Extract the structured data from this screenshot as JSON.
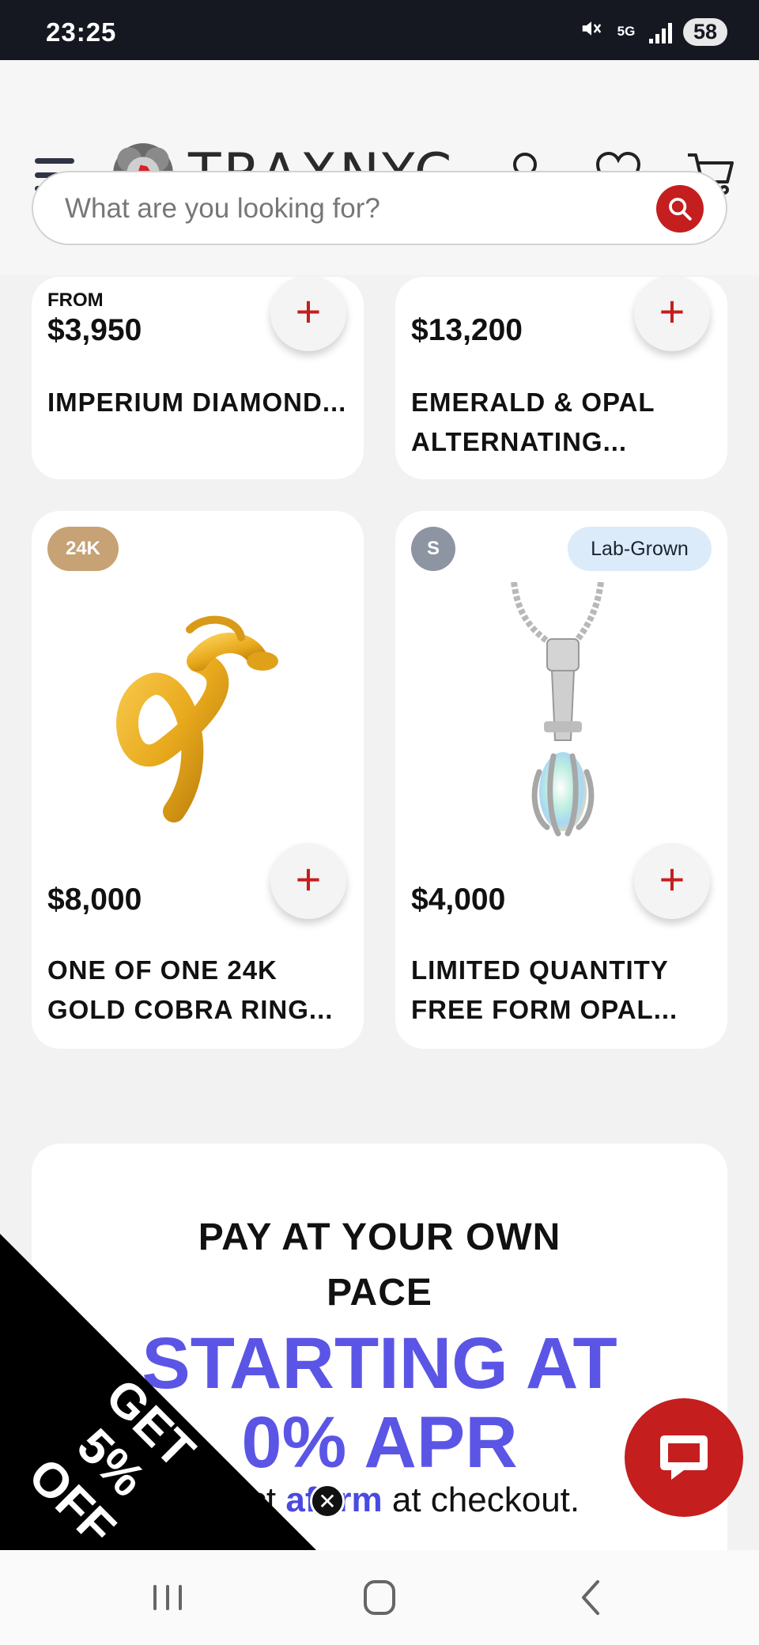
{
  "status_bar": {
    "time": "23:25",
    "network": "5G",
    "battery": "58",
    "icons": [
      "mute-icon",
      "5g-icon",
      "signal-icon",
      "battery-icon"
    ]
  },
  "header": {
    "brand": "TRAXNYC",
    "icons": [
      "menu-icon",
      "logo-icon",
      "account-icon",
      "wishlist-icon",
      "cart-icon"
    ]
  },
  "search": {
    "placeholder": "What are you looking for?",
    "icon": "search-icon"
  },
  "products_top": [
    {
      "from_label": "FROM",
      "price": "$3,950",
      "title": "IMPERIUM DIAMOND..."
    },
    {
      "from_label": "",
      "price": "$13,200",
      "title": "EMERALD & OPAL ALTERNATING..."
    }
  ],
  "products": [
    {
      "badge": "24K",
      "badge_right": "",
      "price": "$8,000",
      "title": "ONE OF ONE 24K GOLD COBRA RING...",
      "image": "gold-cobra-ring-image"
    },
    {
      "badge": "S",
      "badge_right": "Lab-Grown",
      "price": "$4,000",
      "title": "LIMITED QUANTITY FREE FORM OPAL...",
      "image": "opal-claw-pendant-image"
    }
  ],
  "add_button": {
    "label": "+"
  },
  "financing": {
    "heading_line1": "PAY AT YOUR OWN",
    "heading_line2": "PACE",
    "highlight_line1": "STARTING AT",
    "highlight_line2": "0% APR",
    "select_pre": "Select",
    "affirm": "affirm",
    "select_post": "at checkout."
  },
  "promo": {
    "label": "GET 5% OFF",
    "close": "✕"
  },
  "chat": {
    "icon": "chat-icon"
  },
  "colors": {
    "accent": "#c41e1e",
    "apr_purple": "#5b55e6",
    "status_bar": "#161821",
    "badge_24k": "#c6a274",
    "badge_lab_grown": "#dcebfa"
  },
  "nav_bar": {
    "icons": [
      "recent-apps-icon",
      "home-icon",
      "back-icon"
    ]
  }
}
